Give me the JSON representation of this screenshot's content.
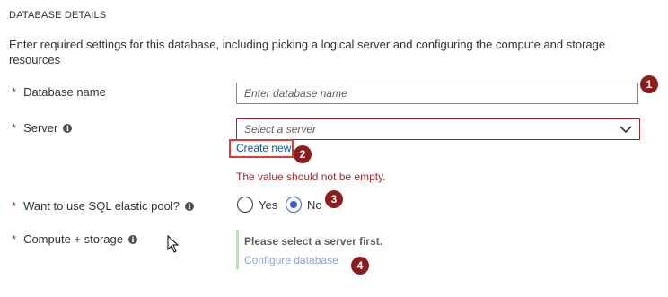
{
  "section": {
    "title": "DATABASE DETAILS",
    "description": "Enter required settings for this database, including picking a logical server and configuring the compute and storage resources"
  },
  "fields": {
    "required_marker": "*",
    "database_name": {
      "label": "Database name",
      "placeholder": "Enter database name",
      "value": ""
    },
    "server": {
      "label": "Server",
      "placeholder": "Select a server",
      "create_new": "Create new",
      "error": "The value should not be empty."
    },
    "elastic_pool": {
      "label": "Want to use SQL elastic pool?",
      "options": [
        "Yes",
        "No"
      ],
      "selected": "No"
    },
    "compute_storage": {
      "label": "Compute + storage",
      "message": "Please select a server first.",
      "link": "Configure database"
    }
  },
  "info_glyph": "i",
  "badges": [
    "1",
    "2",
    "3",
    "4"
  ],
  "colors": {
    "required": "#a4262c",
    "error": "#a4262c",
    "link": "#0058ad",
    "radio_selected": "#3a61c9",
    "badge": "#8b1d1d",
    "highlight_box": "#e53935",
    "compute_bar": "#b7e4a7"
  },
  "icons": [
    "info-icon",
    "chevron-down-icon",
    "mouse-cursor-icon"
  ]
}
